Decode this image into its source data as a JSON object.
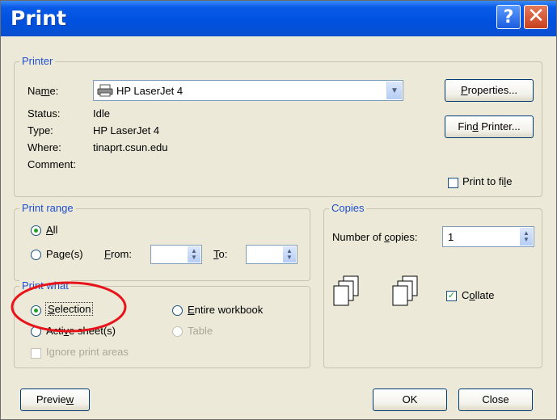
{
  "window": {
    "title": "Print"
  },
  "printer": {
    "legend": "Printer",
    "name_label": "Name:",
    "name_value": "HP LaserJet 4",
    "status_label": "Status:",
    "status_value": "Idle",
    "type_label": "Type:",
    "type_value": "HP LaserJet 4",
    "where_label": "Where:",
    "where_value": "tinaprt.csun.edu",
    "comment_label": "Comment:",
    "properties_label": "Properties...",
    "find_printer_label": "Find Printer...",
    "print_to_file_label": "Print to file",
    "print_to_file_checked": false
  },
  "print_range": {
    "legend": "Print range",
    "all_label": "All",
    "pages_label": "Page(s)",
    "from_label": "From:",
    "to_label": "To:",
    "from_value": "",
    "to_value": "",
    "selected": "all"
  },
  "print_what": {
    "legend": "Print what",
    "selection_label": "Selection",
    "entire_workbook_label": "Entire workbook",
    "active_sheets_label": "Active sheet(s)",
    "table_label": "Table",
    "ignore_print_areas_label": "Ignore print areas",
    "selected": "selection",
    "highlight_color": "#e8141b"
  },
  "copies": {
    "legend": "Copies",
    "number_label": "Number of copies:",
    "number_value": "1",
    "collate_label": "Collate",
    "collate_checked": true
  },
  "footer": {
    "preview_label": "Preview",
    "ok_label": "OK",
    "close_label": "Close"
  },
  "colors": {
    "titlebar": "#0050df",
    "dialog_bg": "#ece9d8",
    "legend_text": "#1f4fd0"
  }
}
